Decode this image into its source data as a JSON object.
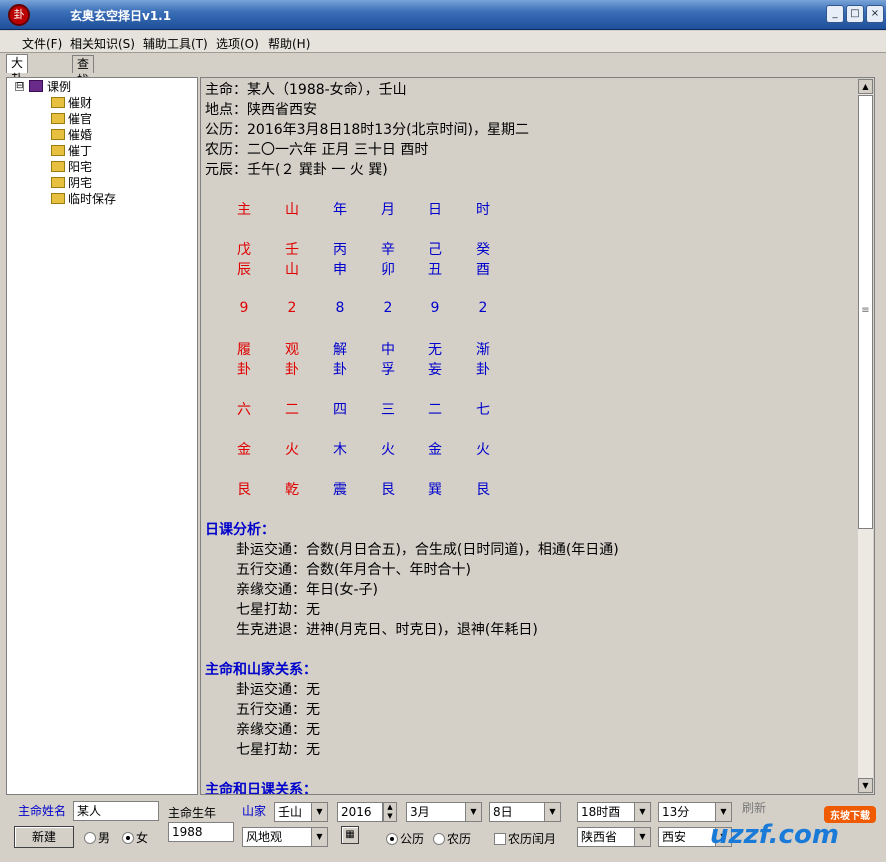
{
  "window": {
    "title": "玄奥玄空择日v1.1",
    "icon_glyph": "卦"
  },
  "menu": [
    "文件(F)",
    "相关知识(S)",
    "辅助工具(T)",
    "选项(O)",
    "帮助(H)"
  ],
  "tabs": [
    "大卦择日",
    "查找日课"
  ],
  "tree": {
    "expander": "⊟",
    "root": "课例",
    "children": [
      "催财",
      "催官",
      "催婚",
      "催丁",
      "阳宅",
      "阴宅",
      "临时保存"
    ]
  },
  "content": {
    "header_lines": [
      "主命：某人（1988-女命），壬山",
      "地点：陕西省西安",
      "公历：2016年3月8日18时13分(北京时间)，星期二",
      "农历：二〇一六年 正月 三十日 酉时",
      "元辰：壬午(２ 巽卦 一 火 巽)"
    ],
    "grid_rows": [
      [
        "主",
        "山",
        "年",
        "月",
        "日",
        "时"
      ],
      [
        "戊",
        "壬",
        "丙",
        "辛",
        "己",
        "癸"
      ],
      [
        "辰",
        "山",
        "申",
        "卯",
        "丑",
        "酉"
      ],
      [
        "9",
        "2",
        "8",
        "2",
        "9",
        "2"
      ],
      [
        "履",
        "观",
        "解",
        "中",
        "无",
        "渐"
      ],
      [
        "卦",
        "卦",
        "卦",
        "孚",
        "妄",
        "卦"
      ],
      [
        "六",
        "二",
        "四",
        "三",
        "二",
        "七"
      ],
      [
        "金",
        "火",
        "木",
        "火",
        "金",
        "火"
      ],
      [
        "艮",
        "乾",
        "震",
        "艮",
        "巽",
        "艮"
      ]
    ],
    "section1_title": "日课分析：",
    "section1_lines": [
      "卦运交通：合数(月日合五)，合生成(日时同道)，相通(年日通)",
      "五行交通：合数(年月合十、年时合十)",
      "亲缘交通：年日(女-子)",
      "七星打劫：无",
      "生克进退：进神(月克日、时克日)，退神(年耗日)"
    ],
    "section2_title": "主命和山家关系：",
    "section2_lines": [
      "卦运交通：无",
      "五行交通：无",
      "亲缘交通：无",
      "七星打劫：无"
    ],
    "section3_title": "主命和日课关系："
  },
  "scrollbar": {
    "up": "▲",
    "down": "▼",
    "grip": "≡"
  },
  "bottom": {
    "name_label": "主命姓名",
    "name_value": "某人",
    "birth_label": "主命生年",
    "birth_value": "1988",
    "new_button": "新建",
    "gender_male": "男",
    "gender_female": "女",
    "shan_label": "山家",
    "shan_value": "壬山",
    "shan2_value": "风地观",
    "year_value": "2016",
    "month_value": "3月",
    "day_value": "8日",
    "hour_value": "18时酉",
    "minute_value": "13分",
    "refresh_label": "刷新",
    "calendar_solar": "公历",
    "calendar_lunar": "农历",
    "leap_month": "农历闰月",
    "province_value": "陕西省",
    "city_value": "西安"
  },
  "watermark": {
    "badge": "东坡下载",
    "text": "uzzf.com"
  }
}
